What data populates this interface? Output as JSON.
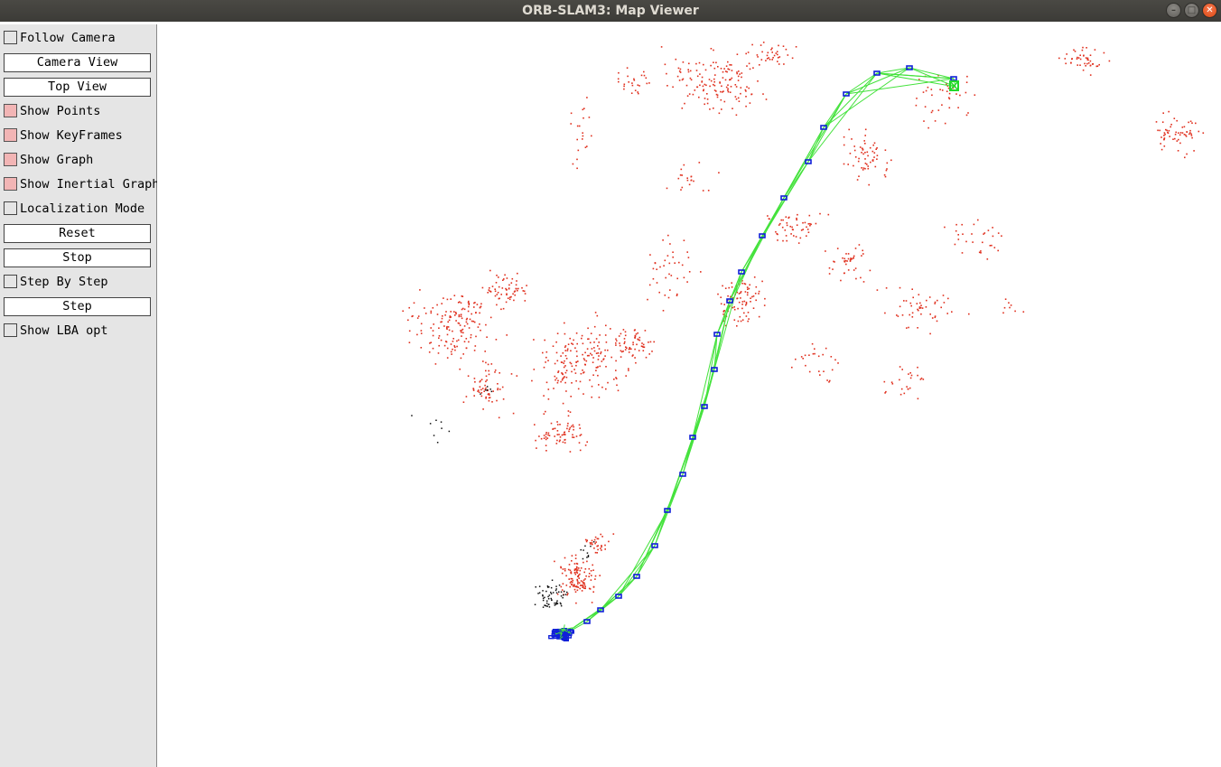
{
  "window": {
    "title": "ORB-SLAM3: Map Viewer",
    "buttons": {
      "minimize": "–",
      "maximize": "□",
      "close": "✕"
    }
  },
  "panel": {
    "follow_camera": "Follow Camera",
    "camera_view": "Camera View",
    "top_view": "Top View",
    "show_points": "Show Points",
    "show_keyframes": "Show KeyFrames",
    "show_graph": "Show Graph",
    "show_inertial_graph": "Show Inertial Graph",
    "localization_mode": "Localization Mode",
    "reset": "Reset",
    "stop": "Stop",
    "step_by_step": "Step By Step",
    "step": "Step",
    "show_lba_opt": "Show LBA opt"
  },
  "colors": {
    "map_points": "#e0301e",
    "reference_points": "#111111",
    "keyframes": "#1020d8",
    "graph_edges": "#44e23c",
    "current_camera": "#22d82a",
    "checkbox_on": "#f2b5b5"
  }
}
